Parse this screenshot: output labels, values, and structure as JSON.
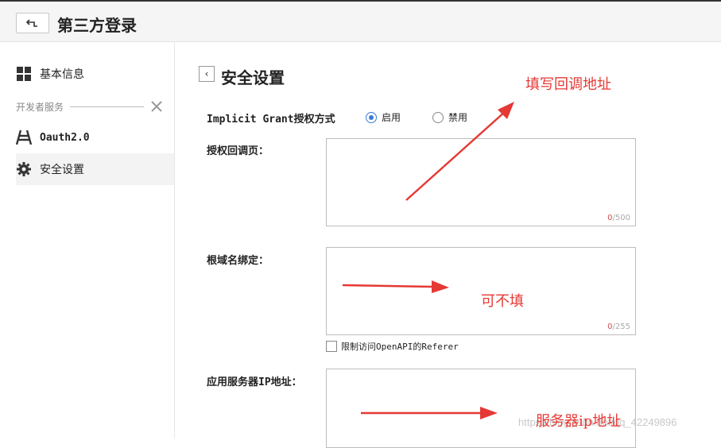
{
  "topbar": {
    "back_icon": "return-icon",
    "title": "第三方登录"
  },
  "sidebar": {
    "items": [
      {
        "label": "基本信息",
        "icon": "grid-icon"
      },
      {
        "label": "Oauth2.0",
        "icon": "oauth-icon"
      },
      {
        "label": "安全设置",
        "icon": "gear-icon"
      }
    ],
    "group_label": "开发者服务",
    "group_icon": "tools-icon"
  },
  "main": {
    "title": "安全设置",
    "implicit": {
      "label": "Implicit Grant授权方式",
      "enable_label": "启用",
      "disable_label": "禁用",
      "selected": "启用"
    },
    "callback": {
      "label": "授权回调页：",
      "count": "0",
      "max": "/500"
    },
    "domain": {
      "label": "根域名绑定：",
      "count": "0",
      "max": "/255"
    },
    "referer": {
      "label": "限制访问OpenAPI的Referer"
    },
    "server_ip": {
      "label": "应用服务器IP地址："
    }
  },
  "annotations": {
    "callback_note": "填写回调地址",
    "domain_note": "可不填",
    "ip_note": "服务器ip地址",
    "color": "#e53935"
  },
  "watermark": "https://blog.csdn.net/qq_42249896",
  "colors": {
    "accent": "#3a7bd5",
    "counter": "#d04b4b"
  }
}
